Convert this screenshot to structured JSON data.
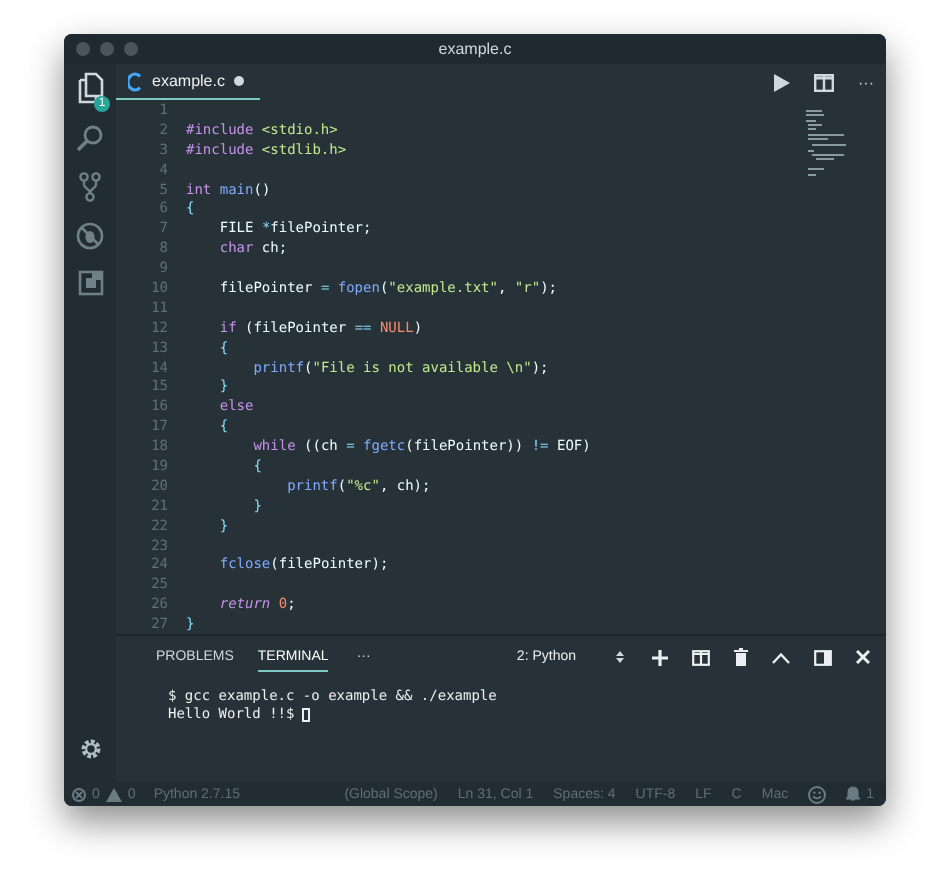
{
  "window": {
    "title": "example.c"
  },
  "activity_bar": {
    "items": [
      {
        "kind": "files",
        "selected": true,
        "badge": "1"
      },
      {
        "kind": "search",
        "selected": false
      },
      {
        "kind": "source-control",
        "selected": false
      },
      {
        "kind": "debug",
        "selected": false
      },
      {
        "kind": "extensions",
        "selected": false
      }
    ]
  },
  "tabs": [
    {
      "label": "example.c",
      "selected": true,
      "modified": true
    }
  ],
  "editor_actions": [
    {
      "kind": "run"
    },
    {
      "kind": "split"
    },
    {
      "kind": "more",
      "label": "···"
    }
  ],
  "editor": {
    "lines": [
      {
        "number": "1"
      },
      {
        "number": "2",
        "tokens": [
          {
            "kind": "keyword",
            "text": "#include"
          },
          {
            "kind": "string",
            "text": " <stdio.h>"
          }
        ]
      },
      {
        "number": "3",
        "tokens": [
          {
            "kind": "keyword",
            "text": "#include"
          },
          {
            "kind": "string",
            "text": " <stdlib.h>"
          }
        ]
      },
      {
        "number": "4"
      },
      {
        "number": "5",
        "tokens": [
          {
            "kind": "keyword",
            "text": "int"
          },
          {
            "kind": "function",
            "text": " main"
          },
          {
            "kind": "plain",
            "text": "()"
          }
        ]
      },
      {
        "number": "6",
        "tokens": [
          {
            "kind": "punct",
            "text": "{"
          }
        ]
      },
      {
        "number": "7",
        "tokens": [
          {
            "kind": "plain",
            "text": "    FILE "
          },
          {
            "kind": "operator",
            "text": "*"
          },
          {
            "kind": "plain",
            "text": "filePointer;"
          }
        ]
      },
      {
        "number": "8",
        "tokens": [
          {
            "kind": "keyword",
            "text": "    char"
          },
          {
            "kind": "plain",
            "text": " ch;"
          }
        ]
      },
      {
        "number": "9"
      },
      {
        "number": "10",
        "tokens": [
          {
            "kind": "plain",
            "text": "    filePointer "
          },
          {
            "kind": "operator",
            "text": "="
          },
          {
            "kind": "function",
            "text": " fopen"
          },
          {
            "kind": "plain",
            "text": "("
          },
          {
            "kind": "string",
            "text": "\"example.txt\""
          },
          {
            "kind": "plain",
            "text": ", "
          },
          {
            "kind": "string",
            "text": "\"r\""
          },
          {
            "kind": "plain",
            "text": ");"
          }
        ]
      },
      {
        "number": "11"
      },
      {
        "number": "12",
        "tokens": [
          {
            "kind": "keyword",
            "text": "    if"
          },
          {
            "kind": "plain",
            "text": " (filePointer "
          },
          {
            "kind": "operator",
            "text": "=="
          },
          {
            "kind": "constant",
            "text": " NULL"
          },
          {
            "kind": "plain",
            "text": ")"
          }
        ]
      },
      {
        "number": "13",
        "tokens": [
          {
            "kind": "punct",
            "text": "    {"
          }
        ]
      },
      {
        "number": "14",
        "tokens": [
          {
            "kind": "function",
            "text": "        printf"
          },
          {
            "kind": "plain",
            "text": "("
          },
          {
            "kind": "string",
            "text": "\"File is not available \\n\""
          },
          {
            "kind": "plain",
            "text": ");"
          }
        ]
      },
      {
        "number": "15",
        "tokens": [
          {
            "kind": "punct",
            "text": "    }"
          }
        ]
      },
      {
        "number": "16",
        "tokens": [
          {
            "kind": "keyword",
            "text": "    else"
          }
        ]
      },
      {
        "number": "17",
        "tokens": [
          {
            "kind": "punct",
            "text": "    {"
          }
        ]
      },
      {
        "number": "18",
        "tokens": [
          {
            "kind": "keyword",
            "text": "        while"
          },
          {
            "kind": "plain",
            "text": " ((ch "
          },
          {
            "kind": "operator",
            "text": "="
          },
          {
            "kind": "function",
            "text": " fgetc"
          },
          {
            "kind": "plain",
            "text": "(filePointer)) "
          },
          {
            "kind": "operator",
            "text": "!="
          },
          {
            "kind": "plain",
            "text": " EOF)"
          }
        ]
      },
      {
        "number": "19",
        "tokens": [
          {
            "kind": "punct",
            "text": "        {"
          }
        ]
      },
      {
        "number": "20",
        "tokens": [
          {
            "kind": "function",
            "text": "            printf"
          },
          {
            "kind": "plain",
            "text": "("
          },
          {
            "kind": "string",
            "text": "\"%c\""
          },
          {
            "kind": "plain",
            "text": ", ch);"
          }
        ]
      },
      {
        "number": "21",
        "tokens": [
          {
            "kind": "punct",
            "text": "        }"
          }
        ]
      },
      {
        "number": "22",
        "tokens": [
          {
            "kind": "punct",
            "text": "    }"
          }
        ]
      },
      {
        "number": "23"
      },
      {
        "number": "24",
        "tokens": [
          {
            "kind": "function",
            "text": "    fclose"
          },
          {
            "kind": "plain",
            "text": "(filePointer);"
          }
        ]
      },
      {
        "number": "25"
      },
      {
        "number": "26",
        "tokens": [
          {
            "kind": "italic-keyword",
            "text": "    return"
          },
          {
            "kind": "constant",
            "text": " 0"
          },
          {
            "kind": "plain",
            "text": ";"
          }
        ]
      },
      {
        "number": "27",
        "tokens": [
          {
            "kind": "punct",
            "text": "}"
          }
        ]
      }
    ]
  },
  "panel": {
    "tabs": [
      {
        "label": "PROBLEMS",
        "selected": false
      },
      {
        "label": "TERMINAL",
        "selected": true
      }
    ],
    "more": "···",
    "terminal_select": "2: Python",
    "actions": [
      {
        "kind": "add"
      },
      {
        "kind": "split"
      },
      {
        "kind": "trash"
      },
      {
        "kind": "chevron-up"
      },
      {
        "kind": "maximize"
      },
      {
        "kind": "close"
      }
    ],
    "terminal_lines": [
      "$ gcc example.c -o example && ./example",
      "Hello World !!$"
    ]
  },
  "status_bar": {
    "errors": "0",
    "warnings": "0",
    "interpreter": "Python 2.7.15",
    "right": [
      "(Global Scope)",
      "Ln 31, Col 1",
      "Spaces: 4",
      "UTF-8",
      "LF",
      "C",
      "Mac"
    ],
    "notifications": "1"
  }
}
